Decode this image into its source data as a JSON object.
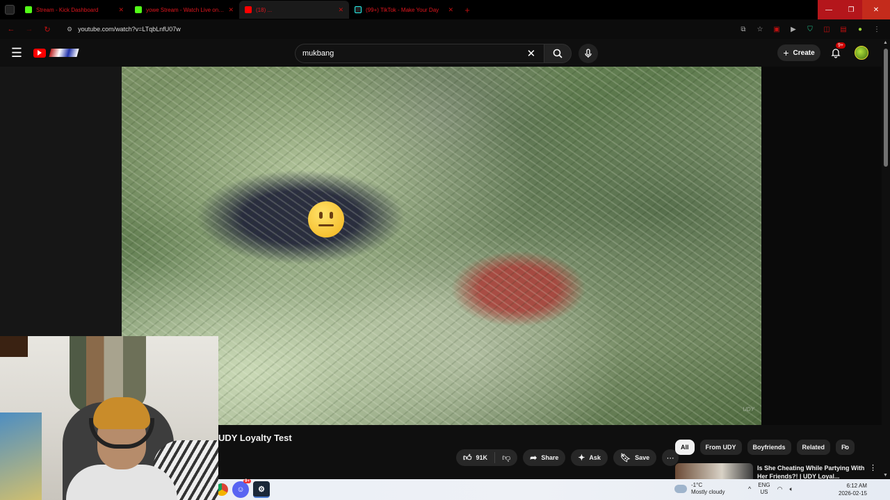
{
  "browser": {
    "tabs": [
      {
        "title": "Stream - Kick Dashboard",
        "color": "#53fc18"
      },
      {
        "title": "yowe Stream - Watch Live on ...",
        "color": "#53fc18"
      },
      {
        "title": "(18) ...",
        "color": "#ff0000"
      },
      {
        "title": "(99+) TikTok - Make Your Day",
        "color": "#111111"
      }
    ],
    "url": "youtube.com/watch?v=LTqbLnfU07w"
  },
  "header": {
    "search_query": "mukbang",
    "create_label": "Create",
    "notification_badge": "9+"
  },
  "video": {
    "title": "UDY Loyalty Test",
    "watermark": "UDY"
  },
  "actions": {
    "like_count": "91K",
    "share_label": "Share",
    "ask_label": "Ask",
    "save_label": "Save"
  },
  "chips": [
    "All",
    "From UDY",
    "Boyfriends",
    "Related",
    "Fo"
  ],
  "recommendation": {
    "title": "Is She Cheating While Partying With Her Friends?! | UDY Loyal..."
  },
  "taskbar": {
    "weather_temp": "-1°C",
    "weather_desc": "Mostly cloudy",
    "lang_top": "ENG",
    "lang_bottom": "US",
    "time": "6:12 AM",
    "date": "2026-02-15",
    "discord_badge": "9+"
  },
  "colors": {
    "accent": "#ff0000",
    "tab_text": "#e0161e",
    "window_close": "#c42b1c"
  }
}
